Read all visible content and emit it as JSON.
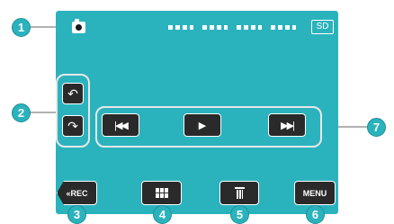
{
  "status_bar": {
    "mode_icon": "camera-icon",
    "media_label": "SD"
  },
  "rotate_buttons": [
    {
      "name": "rotate-left-button",
      "symbol": "↶"
    },
    {
      "name": "rotate-right-button",
      "symbol": "↷"
    }
  ],
  "playback_buttons": {
    "previous_symbol": "|◀◀",
    "play_symbol": "▶",
    "next_symbol": "▶▶|"
  },
  "bottom_bar": {
    "rec_label": "«REC",
    "grid_icon": "grid-icon",
    "delete_icon": "trash-icon",
    "menu_label": "MENU"
  },
  "callouts": [
    "1",
    "2",
    "3",
    "4",
    "5",
    "6",
    "7"
  ],
  "colors": {
    "screen": "#2bb3bd",
    "button_bg": "#2a2a2a",
    "group_border": "#e8e8e8",
    "callout_bg": "#2bb3bd"
  }
}
